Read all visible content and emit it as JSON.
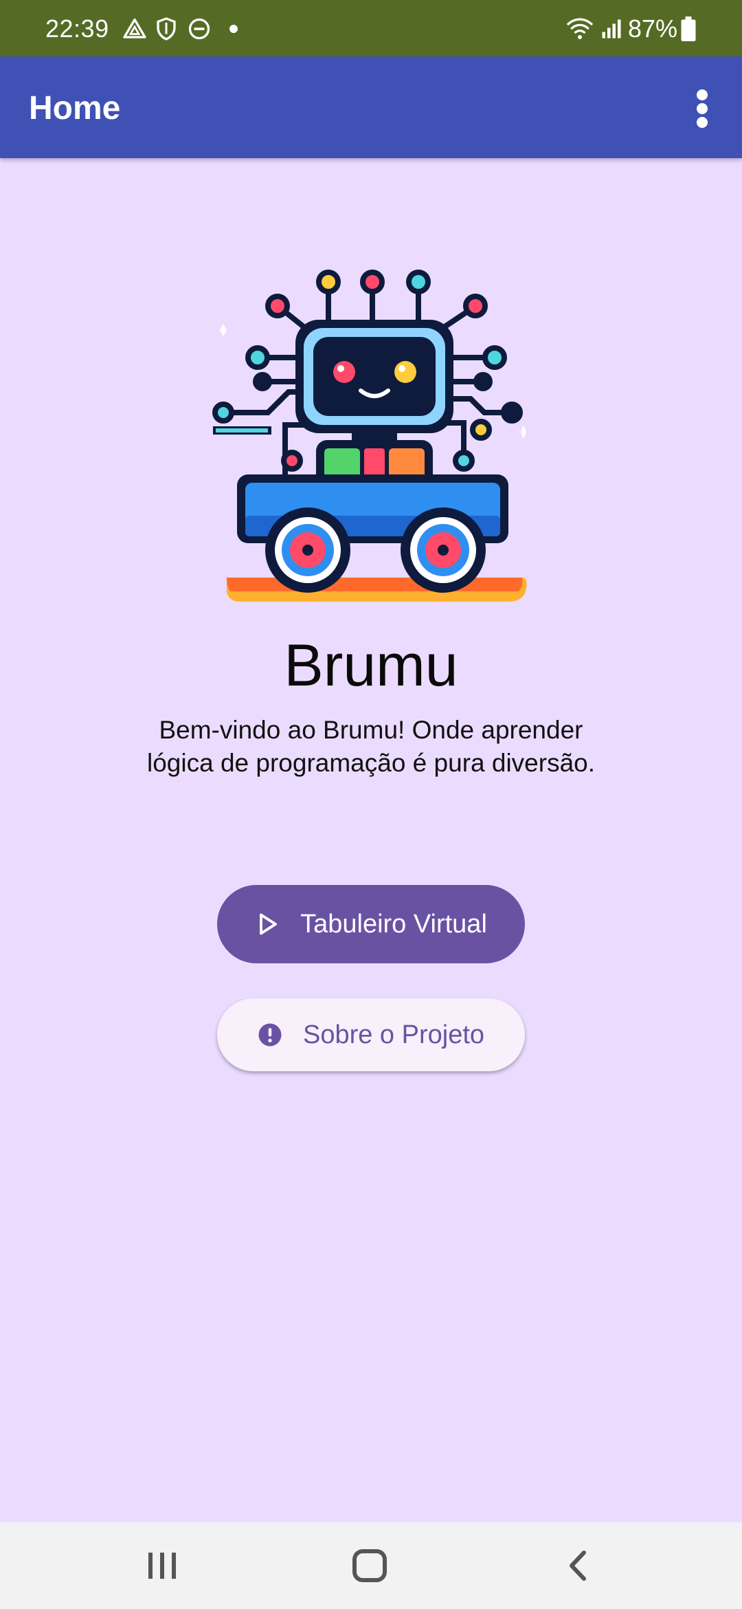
{
  "status_bar": {
    "time": "22:39",
    "battery": "87%",
    "icons": [
      "drive-icon",
      "shield-icon",
      "dnd-icon",
      "dot-icon",
      "wifi-icon",
      "signal-icon",
      "battery-icon"
    ]
  },
  "app_bar": {
    "title": "Home",
    "menu_icon": "more-vert-icon",
    "background": "#3f51b5"
  },
  "main": {
    "logo": "robot-car-logo",
    "app_name": "Brumu",
    "welcome_line1": "Bem-vindo ao Brumu! Onde aprender",
    "welcome_line2": "lógica de programação é pura diversão.",
    "buttons": [
      {
        "label": "Tabuleiro Virtual",
        "icon": "play-icon"
      },
      {
        "label": "Sobre o Projeto",
        "icon": "info-icon"
      }
    ],
    "accent": "#6a52a3",
    "background": "#ebdcff"
  },
  "nav_bar": {
    "icons": [
      "recent-apps-icon",
      "home-icon",
      "back-icon"
    ]
  }
}
